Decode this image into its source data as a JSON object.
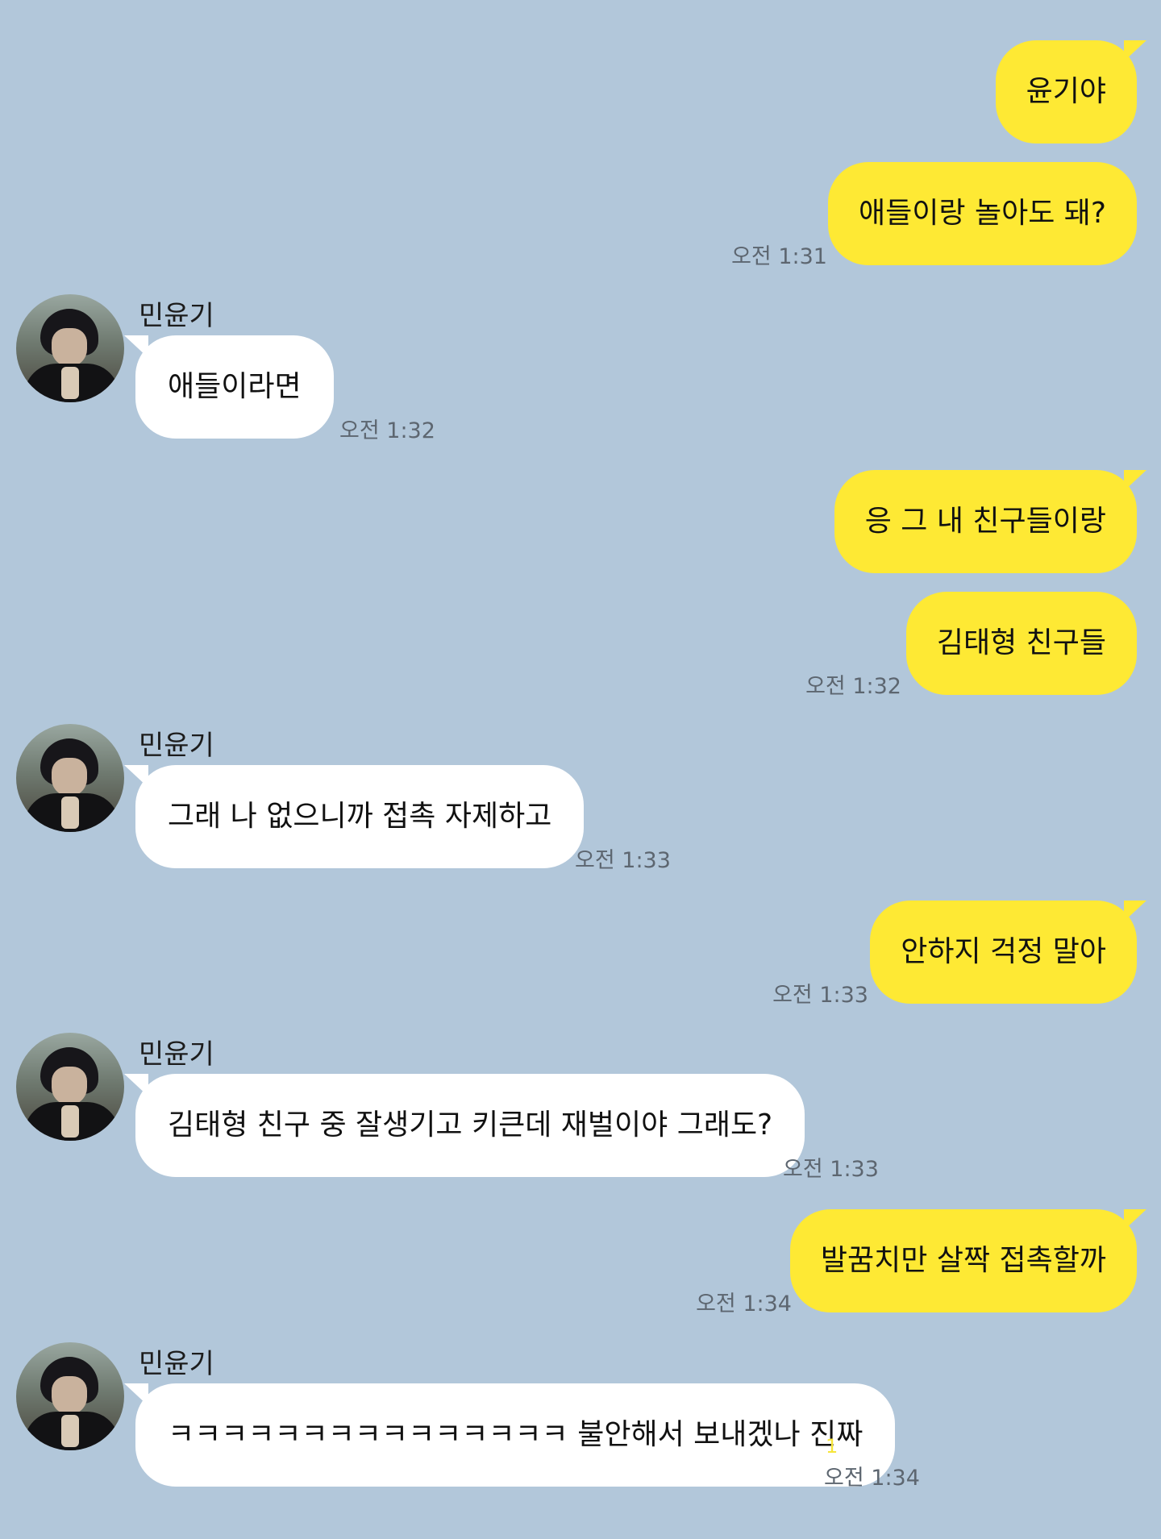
{
  "chat": {
    "sender_name": "민윤기",
    "messages": [
      {
        "from": "me",
        "text": "윤기야"
      },
      {
        "from": "me",
        "text": "애들이랑 놀아도 돼?",
        "time": "오전 1:31"
      },
      {
        "from": "them",
        "text": "애들이라면",
        "time": "오전 1:32"
      },
      {
        "from": "me",
        "text": "응 그 내 친구들이랑"
      },
      {
        "from": "me",
        "text": "김태형 친구들",
        "time": "오전 1:32"
      },
      {
        "from": "them",
        "text": "그래 나 없으니까 접촉 자제하고",
        "time": "오전 1:33"
      },
      {
        "from": "me",
        "text": "안하지 걱정 말아",
        "time": "오전 1:33"
      },
      {
        "from": "them",
        "text": "김태형 친구 중 잘생기고 키큰데 재벌이야 그래도?",
        "time": "오전 1:33"
      },
      {
        "from": "me",
        "text": "발꿈치만 살짝 접촉할까",
        "time": "오전 1:34"
      },
      {
        "from": "them",
        "text": "ㅋㅋㅋㅋㅋㅋㅋㅋㅋㅋㅋㅋㅋㅋㅋ 불안해서 보내겠나 진짜",
        "time": "오전 1:34",
        "unread": "1"
      }
    ]
  },
  "colors": {
    "background": "#b2c7da",
    "my_bubble": "#fee934",
    "their_bubble": "#ffffff",
    "unread": "#f6e53a"
  },
  "icons": {
    "avatar": "profile-photo"
  }
}
